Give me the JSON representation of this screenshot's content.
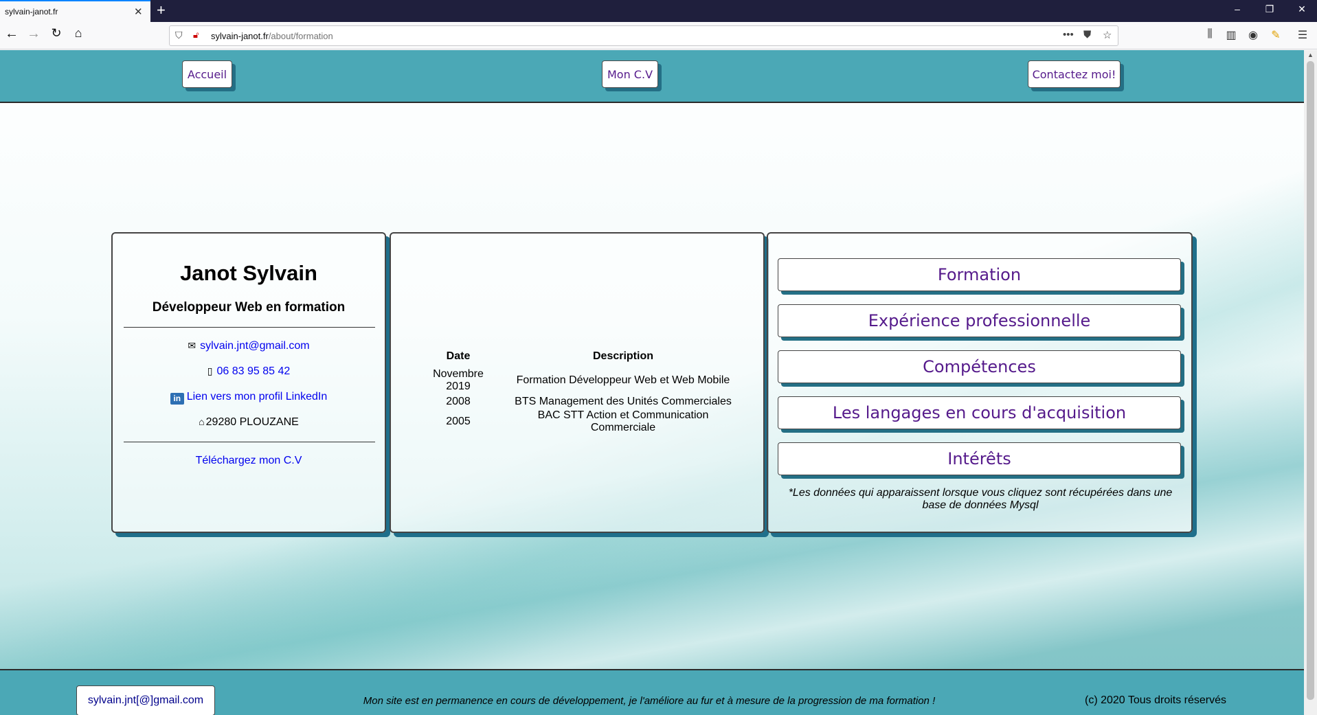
{
  "browser": {
    "tab_title": "sylvain-janot.fr",
    "tab_close": "✕",
    "new_tab": "+",
    "url_host": "sylvain-janot.fr",
    "url_path": "/about/formation",
    "url_more": "•••",
    "window_minimize": "–",
    "window_restore": "❐",
    "window_close": "✕"
  },
  "header": {
    "nav": [
      {
        "label": "Accueil"
      },
      {
        "label": "Mon C.V"
      },
      {
        "label": "Contactez moi!"
      }
    ]
  },
  "profile": {
    "name": "Janot Sylvain",
    "role": "Développeur Web en formation",
    "email": "sylvain.jnt@gmail.com",
    "phone": "06 83 95 85 42",
    "linkedin_icon": "in",
    "linkedin": "Lien vers mon profil LinkedIn",
    "address": "29280 PLOUZANE",
    "download": "Téléchargez mon C.V"
  },
  "formation": {
    "headers": {
      "date": "Date",
      "description": "Description"
    },
    "rows": [
      {
        "date": "Novembre 2019",
        "description": "Formation Développeur Web et Web Mobile"
      },
      {
        "date": "2008",
        "description": "BTS Management des Unités Commerciales"
      },
      {
        "date": "2005",
        "description": "BAC STT Action et Communication Commerciale"
      }
    ]
  },
  "categories": {
    "items": [
      {
        "label": "Formation"
      },
      {
        "label": "Expérience professionnelle"
      },
      {
        "label": "Compétences"
      },
      {
        "label": "Les langages en cours d'acquisition"
      },
      {
        "label": "Intérêts"
      }
    ],
    "note": "*Les données qui apparaissent lorsque vous cliquez sont récupérées dans une base de données Mysql"
  },
  "footer": {
    "email": "sylvain.jnt[@]gmail.com",
    "note": "Mon site est en permanence en cours de développement, je l'améliore au fur et à mesure de la progression de ma formation !",
    "copyright": "(c) 2020 Tous droits réservés"
  },
  "colors": {
    "header_bg": "#4ba8b6",
    "button_shadow": "#246f85",
    "link_visited": "#551a8b",
    "link": "#0000ee"
  },
  "icons": [
    "back-icon",
    "forward-icon",
    "reload-icon",
    "home-icon",
    "shield-icon",
    "insecure-lock-icon",
    "page-actions-icon",
    "pocket-icon",
    "bookmark-star-icon",
    "library-icon",
    "sidebar-icon",
    "account-icon",
    "extension-icon",
    "menu-icon",
    "mail-icon",
    "phone-icon",
    "linkedin-icon",
    "home-address-icon"
  ]
}
